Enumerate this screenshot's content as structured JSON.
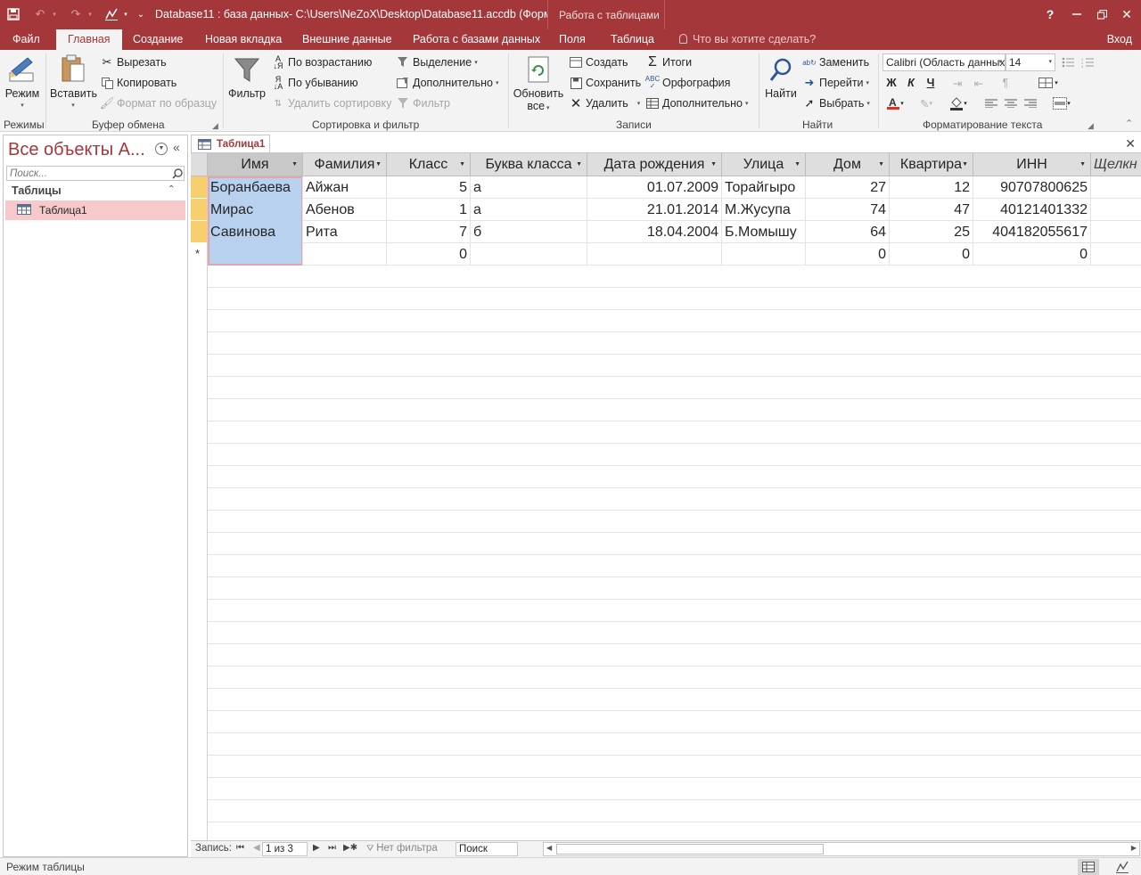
{
  "titlebar": {
    "doc_title": "Database11 : база данных- C:\\Users\\NeZoX\\Desktop\\Database11.accdb (Форм...",
    "context_group": "Работа с таблицами",
    "help": "?"
  },
  "tabs": {
    "file": "Файл",
    "home": "Главная",
    "create": "Создание",
    "new_tab": "Новая вкладка",
    "external": "Внешние данные",
    "database_tools": "Работа с базами данных",
    "fields": "Поля",
    "table": "Таблица",
    "tell_me": "Что вы хотите сделать?",
    "sign_in": "Вход"
  },
  "ribbon": {
    "views": {
      "mode": "Режим",
      "label": "Режимы"
    },
    "clipboard": {
      "paste": "Вставить",
      "cut": "Вырезать",
      "copy": "Копировать",
      "format_painter": "Формат по образцу",
      "label": "Буфер обмена"
    },
    "sort_filter": {
      "filter": "Фильтр",
      "ascending": "По возрастанию",
      "descending": "По убыванию",
      "remove_sort": "Удалить сортировку",
      "selection": "Выделение",
      "advanced": "Дополнительно",
      "toggle_filter": "Фильтр",
      "label": "Сортировка и фильтр"
    },
    "records": {
      "refresh": "Обновить",
      "refresh2": "все",
      "new": "Создать",
      "save": "Сохранить",
      "delete": "Удалить",
      "totals": "Итоги",
      "spelling": "Орфография",
      "more": "Дополнительно",
      "label": "Записи"
    },
    "find": {
      "find": "Найти",
      "replace": "Заменить",
      "goto": "Перейти",
      "select": "Выбрать",
      "label": "Найти"
    },
    "text_format": {
      "font": "Calibri (Область данных)",
      "size": "14",
      "bold": "Ж",
      "italic": "К",
      "underline": "Ч",
      "label": "Форматирование текста"
    }
  },
  "nav": {
    "title": "Все объекты А...",
    "search_placeholder": "Поиск...",
    "group": "Таблицы",
    "item": "Таблица1"
  },
  "document": {
    "tab": "Таблица1",
    "columns": [
      "Имя",
      "Фамилия",
      "Класс",
      "Буква класса",
      "Дата рождения",
      "Улица",
      "Дом",
      "Квартира",
      "ИНН",
      "Щелкн"
    ],
    "rows": [
      [
        "Боранбаева",
        "Айжан",
        "5",
        "а",
        "01.07.2009",
        "Торайгыро",
        "27",
        "12",
        "90707800625"
      ],
      [
        "Мирас",
        "Абенов",
        "1",
        "а",
        "21.01.2014",
        "М.Жусупа",
        "74",
        "47",
        "40121401332"
      ],
      [
        "Савинова",
        "Рита",
        "7",
        "б",
        "18.04.2004",
        "Б.Момышу",
        "64",
        "25",
        "404182055617"
      ]
    ],
    "new_row": [
      "",
      "",
      "0",
      "",
      "",
      "",
      "0",
      "0",
      "0"
    ],
    "new_row_marker": "*"
  },
  "record_nav": {
    "label": "Запись:",
    "position": "1 из 3",
    "filter": "Нет фильтра",
    "search": "Поиск"
  },
  "status": {
    "text": "Режим таблицы"
  }
}
